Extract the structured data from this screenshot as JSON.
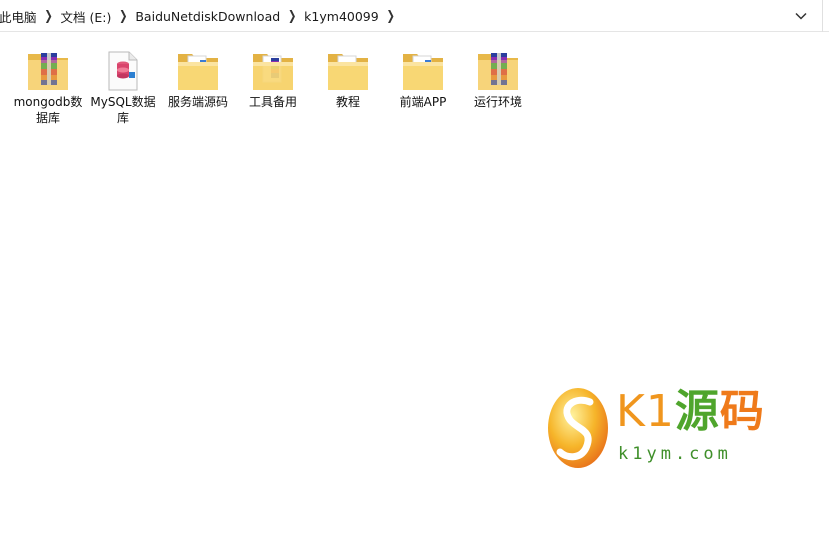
{
  "address_bar": {
    "breadcrumbs": [
      {
        "label": "此电脑"
      },
      {
        "label": "文档 (E:)"
      },
      {
        "label": "BaiduNetdiskDownload"
      },
      {
        "label": "k1ym40099"
      }
    ],
    "dropdown_icon": "chevron-down-icon"
  },
  "files": [
    {
      "name": "mongodb数据库",
      "icon": "winrar-archive-icon",
      "type": "archive"
    },
    {
      "name": "MySQL数据库",
      "icon": "database-file-icon",
      "type": "file"
    },
    {
      "name": "服务端源码",
      "icon": "folder-icon",
      "type": "folder"
    },
    {
      "name": "工具备用",
      "icon": "folder-winrar-icon",
      "type": "folder"
    },
    {
      "name": "教程",
      "icon": "folder-icon",
      "type": "folder"
    },
    {
      "name": "前端APP",
      "icon": "folder-icon",
      "type": "folder"
    },
    {
      "name": "运行环境",
      "icon": "winrar-archive-icon",
      "type": "archive"
    }
  ],
  "watermark": {
    "title_k1": "K1",
    "title_yuan": "源",
    "title_ma": "码",
    "subtitle": "k1ym.com",
    "colors": {
      "orange": "#f0961e",
      "green": "#4fa52c"
    }
  }
}
